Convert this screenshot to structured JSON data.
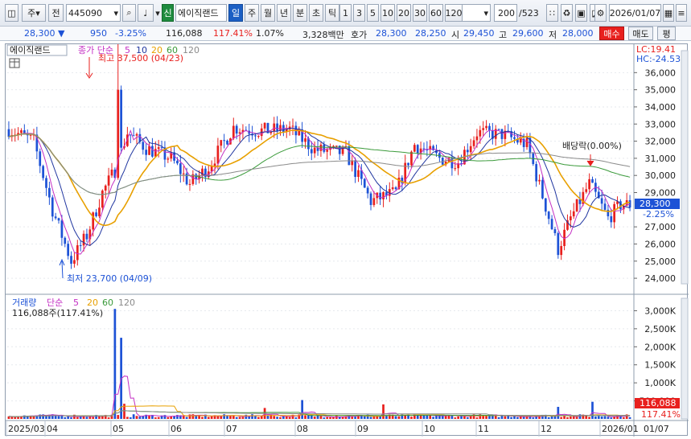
{
  "toolbar": {
    "market_tab": "주",
    "prefix_tab": "전",
    "stock_code": "445090",
    "credit_badge": "신",
    "stock_name": "에이직랜드",
    "period_tabs": [
      "일",
      "주",
      "월",
      "년",
      "분",
      "초",
      "틱"
    ],
    "interval_tabs": [
      "1",
      "3",
      "5",
      "10",
      "20",
      "30",
      "60",
      "120"
    ],
    "count_value": "200",
    "count_total": "/523",
    "date_value": "2026/01/07"
  },
  "quote": {
    "price": "28,300",
    "change": "950",
    "change_pct": "-3.25%",
    "volume": "116,088",
    "volume_ratio": "117.41%",
    "turnover": "1.07%",
    "amount": "3,328백만",
    "ask_label": "호가",
    "ask": "28,300",
    "bid": "28,250",
    "open_label": "시",
    "open": "29,450",
    "high_label": "고",
    "high": "29,600",
    "low_label": "저",
    "low": "28,000",
    "buy_label": "매수",
    "sell_label": "매도",
    "eval_label": "평"
  },
  "price_panel": {
    "name_label": "에이직랜드",
    "legend_prefix": "종가 단순",
    "ma_periods": [
      "5",
      "10",
      "20",
      "60",
      "120"
    ],
    "high_marker": "최고 37,500 (04/23)",
    "low_marker": "최저 23,700 (04/09)",
    "dividend_marker": "배당락(0.00%)",
    "lc_label": "LC:19.41",
    "hc_label": "HC:-24.53",
    "y_ticks": [
      "36,000",
      "35,000",
      "34,000",
      "33,000",
      "32,000",
      "31,000",
      "30,000",
      "29,000",
      "27,000",
      "26,000",
      "25,000",
      "24,000"
    ],
    "current_price_tag": "28,300",
    "current_change_tag": "-2.25%"
  },
  "volume_panel": {
    "title": "거래량",
    "legend_prefix": "단순",
    "ma_periods": [
      "5",
      "20",
      "60",
      "120"
    ],
    "volume_label": "116,088주(117.41%)",
    "y_ticks": [
      "3,000K",
      "2,500K",
      "2,000K",
      "1,500K",
      "1,000K",
      "500,000"
    ],
    "current_volume_tag": "116,088",
    "current_pct_tag": "117.41%"
  },
  "x_axis": {
    "labels": [
      "2025/03",
      "04",
      "05",
      "06",
      "07",
      "08",
      "09",
      "10",
      "11",
      "12",
      "2026/01",
      "01/07"
    ]
  },
  "colors": {
    "up": "#e8201e",
    "down": "#1d52d6",
    "ma5": "#c430c4",
    "ma10": "#2036a0",
    "ma20": "#e8a000",
    "ma60": "#3a9a3a",
    "ma120": "#8a8a8a"
  }
}
